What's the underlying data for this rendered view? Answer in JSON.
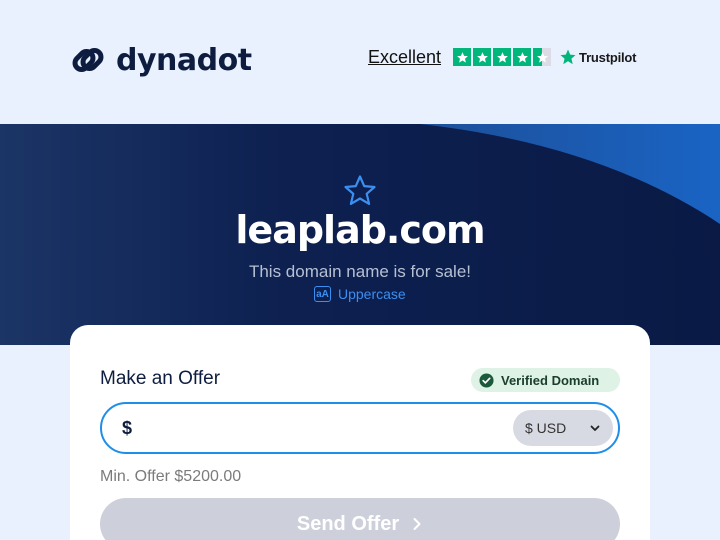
{
  "header": {
    "brand": "dynadot",
    "rating_label": "Excellent",
    "rating_stars": 4.5,
    "rating_max": 5,
    "trustpilot": "Trustpilot",
    "star_color": "#00b67a"
  },
  "hero": {
    "favorite_icon": "star-outline-icon",
    "domain": "leaplab.com",
    "subtitle": "This domain name is for sale!",
    "case_toggle_icon": "aA",
    "case_toggle_label": "Uppercase"
  },
  "offer_card": {
    "title": "Make an Offer",
    "verified_label": "Verified Domain",
    "currency_symbol": "$",
    "amount_value": "",
    "currency_selected": "$ USD",
    "min_offer": "Min. Offer $5200.00",
    "send_label": "Send Offer",
    "accent_color": "#1f8ee8"
  }
}
